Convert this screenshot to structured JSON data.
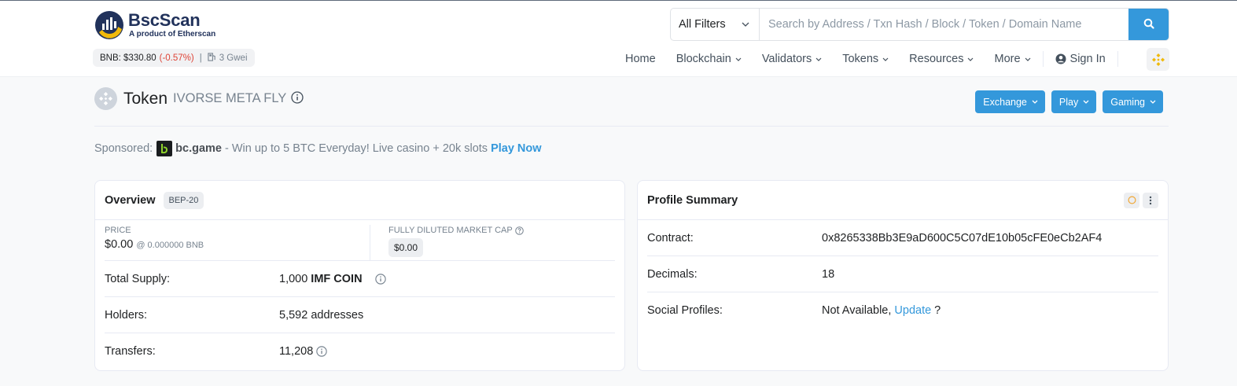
{
  "header": {
    "logo_name": "BscScan",
    "logo_sub": "A product of Etherscan",
    "bnb_price_label": "BNB: $330.80",
    "bnb_change": "(-0.57%)",
    "separator": "|",
    "gas": "3 Gwei"
  },
  "search": {
    "filter_label": "All Filters",
    "placeholder": "Search by Address / Txn Hash / Block / Token / Domain Name"
  },
  "nav": {
    "items": [
      "Home",
      "Blockchain",
      "Validators",
      "Tokens",
      "Resources",
      "More"
    ],
    "sign_in": "Sign In"
  },
  "page": {
    "title_word": "Token",
    "token_name": "IVORSE META FLY",
    "buttons": [
      "Exchange",
      "Play",
      "Gaming"
    ]
  },
  "sponsor": {
    "prefix": "Sponsored:",
    "brand": "bc.game",
    "text": "- Win up to 5 BTC Everyday! Live casino + 20k slots",
    "cta": "Play Now"
  },
  "overview": {
    "title": "Overview",
    "badge": "BEP-20",
    "price_label": "PRICE",
    "price_value": "$0.00",
    "price_bnb": "@ 0.000000 BNB",
    "mcap_label": "FULLY DILUTED MARKET CAP",
    "mcap_value": "$0.00",
    "rows": [
      {
        "key": "Total Supply:",
        "value": "1,000",
        "unit": "IMF COIN"
      },
      {
        "key": "Holders:",
        "value": "5,592 addresses"
      },
      {
        "key": "Transfers:",
        "value": "11,208"
      }
    ]
  },
  "profile": {
    "title": "Profile Summary",
    "contract_label": "Contract:",
    "contract_value": "0x8265338Bb3E9aD600C5C07dE10b05cFE0eCb2AF4",
    "decimals_label": "Decimals:",
    "decimals_value": "18",
    "social_label": "Social Profiles:",
    "social_value": "Not Available,",
    "social_link": "Update",
    "social_q": "?"
  },
  "colors": {
    "accent": "#3498db",
    "negative": "#de4437",
    "brand_dark": "#21325b",
    "bnb_yellow": "#f0b90b"
  }
}
